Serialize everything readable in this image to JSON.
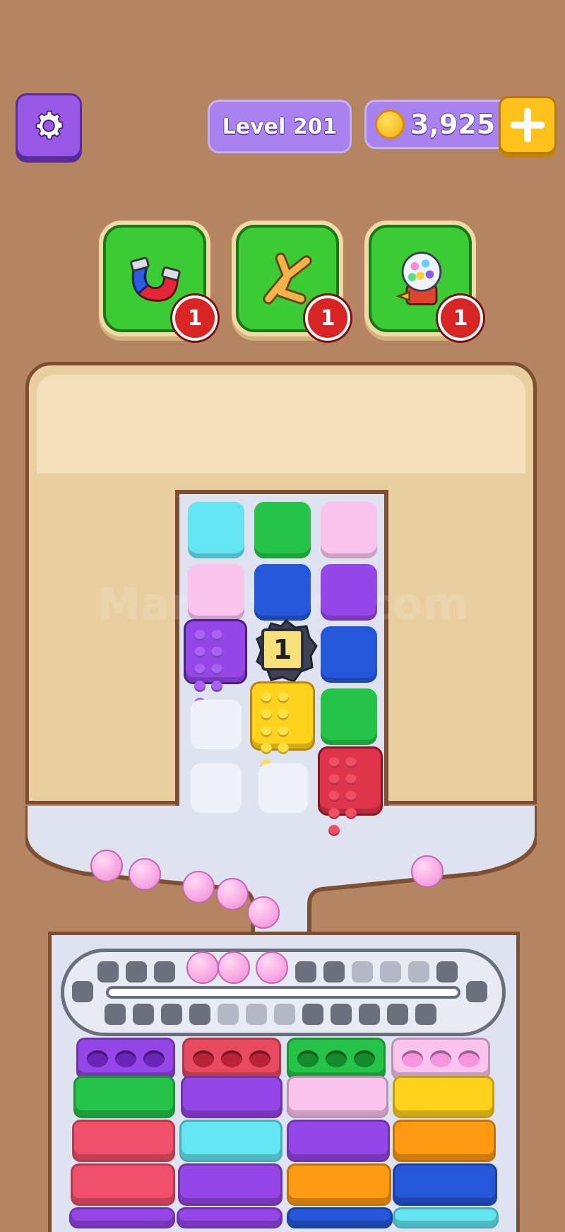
{
  "header": {
    "level_label": "Level 201",
    "coin_count": "3,925"
  },
  "boosters": [
    {
      "name": "magnet",
      "count": "1"
    },
    {
      "name": "shuffle",
      "count": "1"
    },
    {
      "name": "gumball-machine",
      "count": "1"
    }
  ],
  "watermark": "ManiaSort.com",
  "board": {
    "locked_tile_count": "1",
    "columns": [
      [
        "cyan",
        "pink",
        "purple-pins",
        "empty",
        "empty"
      ],
      [
        "green",
        "blue",
        "locked",
        "yellow-pins",
        "empty"
      ],
      [
        "pink",
        "purple",
        "blue",
        "green",
        "red-pins"
      ]
    ]
  },
  "colors": {
    "background": "#b58460",
    "cyan": "#63e6f2",
    "green": "#25c448",
    "pink": "#fbc4ef",
    "blue": "#2558d8",
    "purple": "#9546e6",
    "yellow": "#ffd21c",
    "red": "#e0344a",
    "orange": "#ff9a12",
    "ball": "#f7a8e4"
  },
  "conveyor": {
    "balls_on_track": 3,
    "container_stacks": [
      [
        "purple",
        "green",
        "red",
        "red",
        "purple"
      ],
      [
        "red",
        "purple",
        "cyan",
        "purple",
        "purple"
      ],
      [
        "green",
        "pink",
        "purple",
        "orange",
        "blue"
      ],
      [
        "pink",
        "yellow",
        "orange",
        "blue",
        "cyan"
      ]
    ]
  }
}
